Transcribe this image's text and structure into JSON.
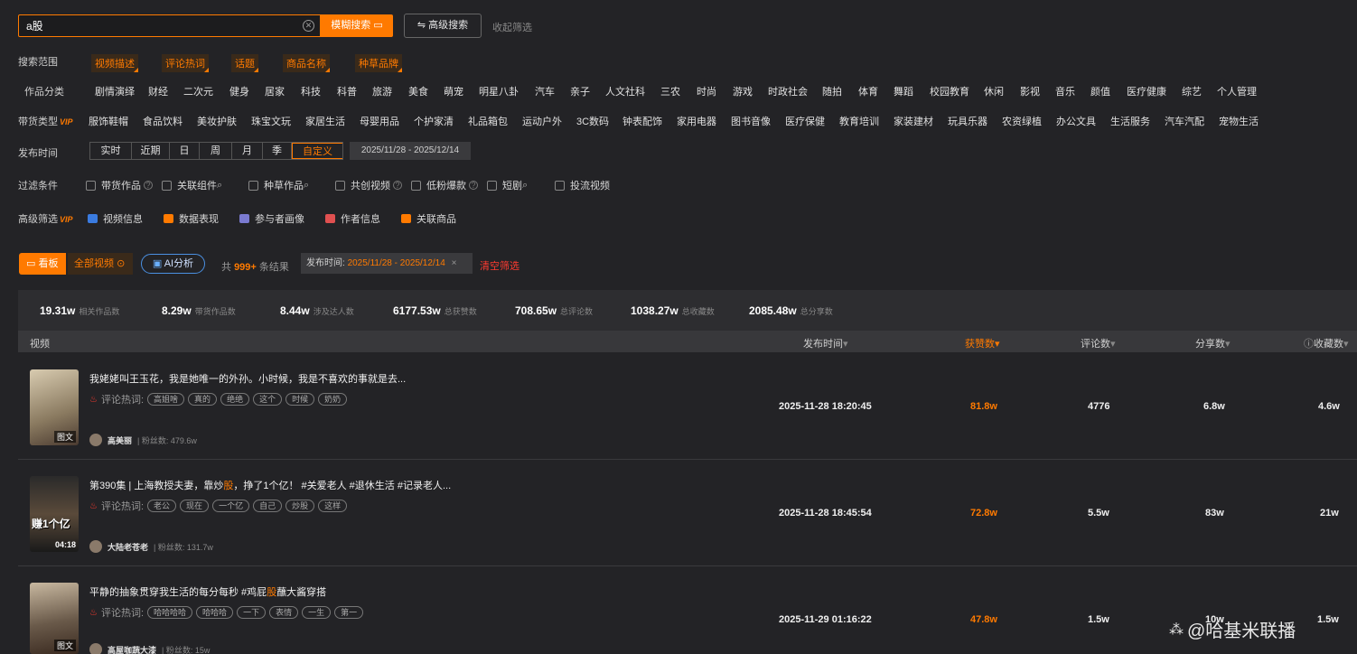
{
  "search": {
    "value": "a股",
    "button": "模糊搜索",
    "advanced": "高级搜索",
    "collapse": "收起筛选"
  },
  "scope": {
    "label": "搜索范围",
    "tags": [
      "视频描述",
      "评论热词",
      "话题",
      "商品名称",
      "种草品牌"
    ]
  },
  "work_category": {
    "label": "作品分类",
    "items": [
      "剧情演绎",
      "财经",
      "二次元",
      "健身",
      "居家",
      "科技",
      "科普",
      "旅游",
      "美食",
      "萌宠",
      "明星八卦",
      "汽车",
      "亲子",
      "人文社科",
      "三农",
      "时尚",
      "游戏",
      "时政社会",
      "随拍",
      "体育",
      "舞蹈",
      "校园教育",
      "休闲",
      "影视",
      "音乐",
      "颜值",
      "医疗健康",
      "综艺",
      "个人管理"
    ]
  },
  "goods_type": {
    "label": "带货类型",
    "vip": "VIP",
    "items": [
      "服饰鞋帽",
      "食品饮料",
      "美妆护肤",
      "珠宝文玩",
      "家居生活",
      "母婴用品",
      "个护家清",
      "礼品箱包",
      "运动户外",
      "3C数码",
      "钟表配饰",
      "家用电器",
      "图书音像",
      "医疗保健",
      "教育培训",
      "家装建材",
      "玩具乐器",
      "农资绿植",
      "办公文具",
      "生活服务",
      "汽车汽配",
      "宠物生活"
    ]
  },
  "publish_time": {
    "label": "发布时间",
    "options": [
      "实时",
      "近期",
      "日",
      "周",
      "月",
      "季",
      "自定义"
    ],
    "active": "自定义",
    "range": "2025/11/28 - 2025/12/14"
  },
  "filters": {
    "label": "过滤条件",
    "items": [
      "带货作品",
      "关联组件",
      "种草作品",
      "共创视频",
      "低粉爆款",
      "短剧",
      "投流视频"
    ]
  },
  "advanced": {
    "label": "高级筛选",
    "vip": "VIP",
    "items": [
      "视频信息",
      "数据表现",
      "参与者画像",
      "作者信息",
      "关联商品"
    ]
  },
  "summary": {
    "kanban": "看板",
    "all_video": "全部视频",
    "ai": "AI分析",
    "count_prefix": "共",
    "count": "999+",
    "count_suffix": "条结果",
    "pub_label": "发布时间:",
    "pub_value": "2025/11/28 - 2025/12/14",
    "clear": "清空筛选"
  },
  "stats": [
    {
      "value": "19.31w",
      "label": "相关作品数"
    },
    {
      "value": "8.29w",
      "label": "带货作品数"
    },
    {
      "value": "8.44w",
      "label": "涉及达人数"
    },
    {
      "value": "6177.53w",
      "label": "总获赞数"
    },
    {
      "value": "708.65w",
      "label": "总评论数"
    },
    {
      "value": "1038.27w",
      "label": "总收藏数"
    },
    {
      "value": "2085.48w",
      "label": "总分享数"
    }
  ],
  "table": {
    "headers": {
      "video": "视频",
      "time": "发布时间",
      "likes": "获赞数",
      "comments": "评论数",
      "shares": "分享数",
      "favs": "收藏数"
    },
    "hot_label": "评论热词:",
    "fans_label": "粉丝数:",
    "rows": [
      {
        "title": "我姥姥叫王玉花，我是她唯一的外孙。小时候，我是不喜欢的事就是去...",
        "badge": "图文",
        "keywords": [
          "高姐啥",
          "真的",
          "绝绝",
          "这个",
          "时候",
          "奶奶"
        ],
        "author": "高美丽",
        "fans": "479.6w",
        "time": "2025-11-28 18:20:45",
        "likes": "81.8w",
        "comments": "4776",
        "shares": "6.8w",
        "favs": "4.6w"
      },
      {
        "title_pre": "第390集 | 上海教授夫妻，靠炒",
        "title_hl": "股",
        "title_post": "，挣了1个亿！ #关爱老人 #退休生活 #记录老人...",
        "badge": "04:18",
        "overlay": "赚1个亿",
        "keywords": [
          "老公",
          "现在",
          "一个亿",
          "自己",
          "炒股",
          "这样"
        ],
        "author": "大陆老苍老",
        "fans": "131.7w",
        "time": "2025-11-28 18:45:54",
        "likes": "72.8w",
        "comments": "5.5w",
        "shares": "83w",
        "favs": "21w"
      },
      {
        "title_pre": "平静的抽象贯穿我生活的每分每秒 #鸡屁",
        "title_hl": "股",
        "title_post": "蘸大酱穿搭",
        "badge": "图文",
        "keywords": [
          "哈哈哈哈",
          "哈哈哈",
          "一下",
          "表情",
          "一生",
          "第一"
        ],
        "author": "高屋咖蔬大漆",
        "fans": "15w",
        "time": "2025-11-29 01:16:22",
        "likes": "47.8w",
        "comments": "1.5w",
        "shares": "10w",
        "favs": "1.5w"
      }
    ]
  },
  "watermark": "@哈基米联播"
}
